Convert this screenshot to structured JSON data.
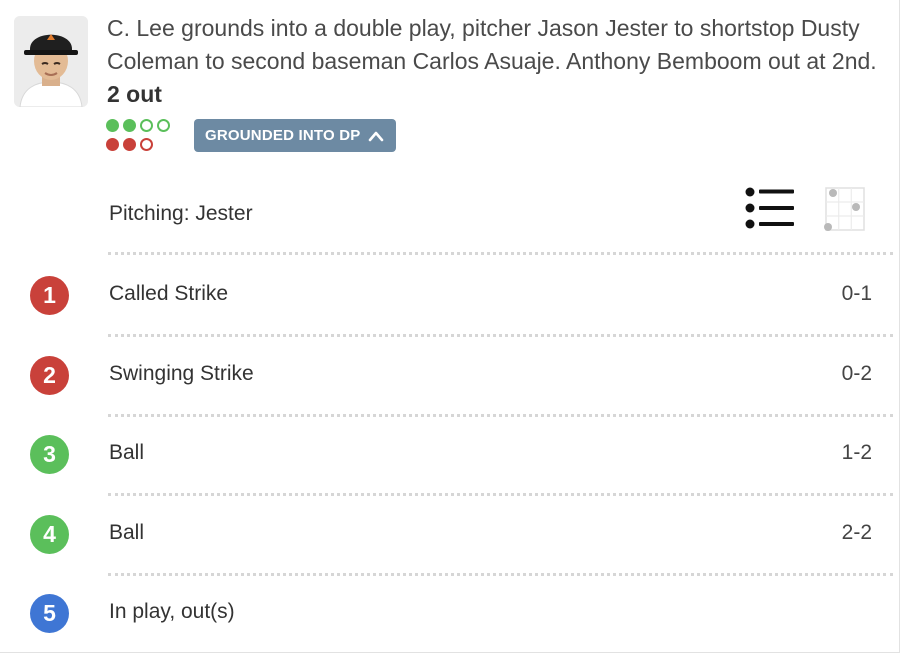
{
  "play": {
    "description": "C. Lee grounds into a double play, pitcher Jason Jester to shortstop Dusty Coleman to second baseman Carlos Asuaje. Anthony Bemboom out at 2nd.",
    "outs_text": "2 out",
    "balls_dots": [
      "filled",
      "filled",
      "empty",
      "empty"
    ],
    "strikes_dots": [
      "filled",
      "filled",
      "empty"
    ],
    "ball_color": "#5bbf5b",
    "strike_color": "#c9413a",
    "result_badge": "GROUNDED INTO DP",
    "result_badge_icon": "chevron-up-icon"
  },
  "pitching": {
    "label": "Pitching: Jester",
    "view_icons": [
      "list-view-icon",
      "strike-zone-view-icon"
    ]
  },
  "pitches": [
    {
      "number": "1",
      "label": "Called Strike",
      "count": "0-1",
      "color": "#c9413a"
    },
    {
      "number": "2",
      "label": "Swinging Strike",
      "count": "0-2",
      "color": "#c9413a"
    },
    {
      "number": "3",
      "label": "Ball",
      "count": "1-2",
      "color": "#5bbf5b"
    },
    {
      "number": "4",
      "label": "Ball",
      "count": "2-2",
      "color": "#5bbf5b"
    },
    {
      "number": "5",
      "label": "In play, out(s)",
      "count": "",
      "color": "#3f76d4"
    }
  ]
}
